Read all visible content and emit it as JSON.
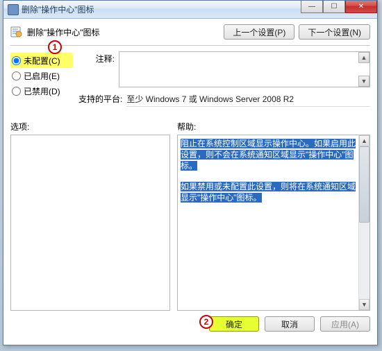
{
  "window": {
    "title": "删除\"操作中心\"图标"
  },
  "header": {
    "text": "删除\"操作中心\"图标",
    "prev_btn": "上一个设置(P)",
    "next_btn": "下一个设置(N)"
  },
  "radios": {
    "not_configured": "未配置(C)",
    "enabled": "已启用(E)",
    "disabled": "已禁用(D)"
  },
  "callouts": {
    "one": "1",
    "two": "2"
  },
  "fields": {
    "comment_label": "注释:",
    "platform_label": "支持的平台:",
    "platform_value": "至少 Windows 7 或 Windows Server 2008 R2"
  },
  "lower": {
    "options_label": "选项:",
    "help_label": "帮助:"
  },
  "help": {
    "p1": "阻止在系统控制区域显示操作中心。如果启用此设置，则不会在系统通知区域显示\"操作中心\"图标。",
    "p2": "如果禁用或未配置此设置，则将在系统通知区域显示\"操作中心\"图标。"
  },
  "footer": {
    "ok": "确定",
    "cancel": "取消",
    "apply": "应用(A)"
  },
  "glyphs": {
    "up": "▲",
    "down": "▼",
    "minimize": "—",
    "maximize": "☐",
    "close": "✕"
  }
}
